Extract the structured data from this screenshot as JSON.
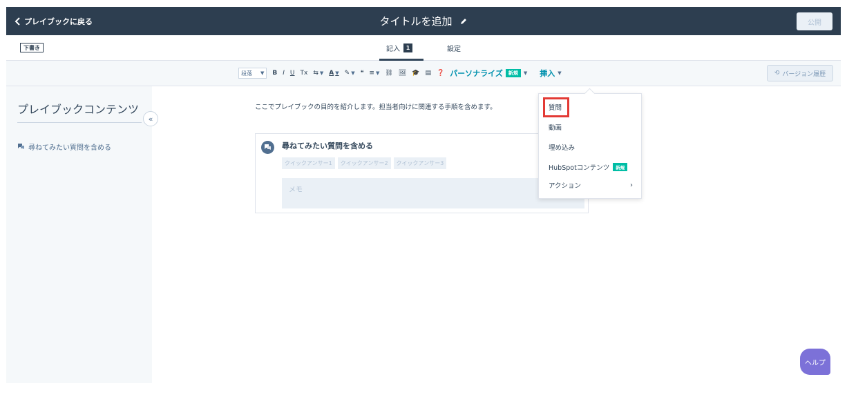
{
  "header": {
    "back_label": "プレイブックに戻る",
    "title": "タイトルを追加",
    "publish_label": "公開"
  },
  "subbar": {
    "draft_label": "下書き",
    "tabs": [
      {
        "label": "記入",
        "count": "1"
      },
      {
        "label": "設定"
      }
    ]
  },
  "toolbar": {
    "paragraph_select": "段落",
    "buttons": [
      "B",
      "I",
      "U",
      "Tx",
      "⇆",
      "A",
      "✎",
      "❝",
      "≡",
      "⛓",
      "🖼",
      "🎓",
      "▤",
      "❓"
    ],
    "personalize_label": "パーソナライズ",
    "new_badge": "新規",
    "insert_label": "挿入",
    "version_label": "バージョン履歴"
  },
  "sidebar": {
    "title": "プレイブックコンテンツ",
    "collapse_symbol": "«",
    "items": [
      {
        "label": "尋ねてみたい質問を含める"
      }
    ]
  },
  "content": {
    "intro": "ここでプレイブックの目的を紹介します。担当者向けに関連する手順を含めます。",
    "question_card": {
      "title": "尋ねてみたい質問を含める",
      "answers": [
        "クイックアンサー1",
        "クイックアンサー2",
        "クイックアンサー3"
      ],
      "memo_placeholder": "メモ"
    }
  },
  "insert_menu": {
    "items": [
      {
        "label": "質問"
      },
      {
        "label": "動画"
      },
      {
        "label": "埋め込み"
      },
      {
        "label": "HubSpotコンテンツ",
        "badge": "新規"
      },
      {
        "label": "アクション",
        "chevron": "›"
      }
    ]
  },
  "help": {
    "label": "ヘルプ"
  },
  "colors": {
    "header_bg": "#2d3e50",
    "link": "#0091ae",
    "new_badge": "#00bda5",
    "highlight": "#e33a35",
    "help": "#7c71d8"
  }
}
